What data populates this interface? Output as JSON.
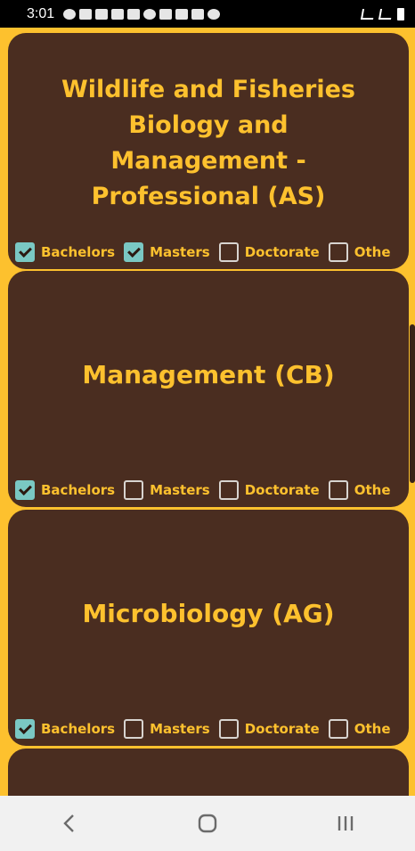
{
  "status_bar": {
    "time": "3:01"
  },
  "cards": [
    {
      "title": "Wildlife and Fisheries Biology and Management - Professional (AS)",
      "degrees": [
        {
          "label": "Bachelors",
          "checked": true
        },
        {
          "label": "Masters",
          "checked": true
        },
        {
          "label": "Doctorate",
          "checked": false
        },
        {
          "label": "Othe",
          "checked": false
        }
      ]
    },
    {
      "title": "Management (CB)",
      "degrees": [
        {
          "label": "Bachelors",
          "checked": true
        },
        {
          "label": "Masters",
          "checked": false
        },
        {
          "label": "Doctorate",
          "checked": false
        },
        {
          "label": "Othe",
          "checked": false
        }
      ]
    },
    {
      "title": "Microbiology (AG)",
      "degrees": [
        {
          "label": "Bachelors",
          "checked": true
        },
        {
          "label": "Masters",
          "checked": false
        },
        {
          "label": "Doctorate",
          "checked": false
        },
        {
          "label": "Othe",
          "checked": false
        }
      ]
    }
  ],
  "colors": {
    "background": "#fdc12e",
    "card": "#4a2d20",
    "title": "#fdc12e",
    "checkbox_checked": "#7ac8c3"
  },
  "nav": {
    "back_icon": "back-icon",
    "home_icon": "home-icon",
    "recents_icon": "recents-icon"
  }
}
